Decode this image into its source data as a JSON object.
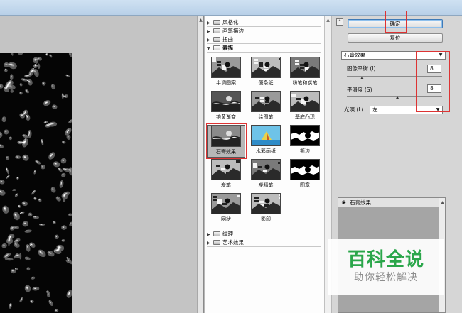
{
  "window": {
    "accent": "#b8d0e8"
  },
  "gallery": {
    "categories_top": [
      {
        "label": "风格化",
        "expanded": false
      },
      {
        "label": "画笔描边",
        "expanded": false
      },
      {
        "label": "扭曲",
        "expanded": false
      },
      {
        "label": "素描",
        "expanded": true
      }
    ],
    "filters": [
      {
        "label": "半调图案",
        "icon": "halftone-thumb"
      },
      {
        "label": "便条纸",
        "icon": "note-paper-thumb"
      },
      {
        "label": "粉笔和炭笔",
        "icon": "chalk-charcoal-thumb"
      },
      {
        "label": "铬黄渐变",
        "icon": "chrome-thumb"
      },
      {
        "label": "绘图笔",
        "icon": "graphic-pen-thumb"
      },
      {
        "label": "基底凸现",
        "icon": "bas-relief-thumb"
      },
      {
        "label": "石膏效果",
        "icon": "plaster-thumb",
        "selected": true
      },
      {
        "label": "水彩画纸",
        "icon": "water-paper-thumb"
      },
      {
        "label": "撕边",
        "icon": "torn-edges-thumb"
      },
      {
        "label": "炭笔",
        "icon": "charcoal-thumb"
      },
      {
        "label": "炭精笔",
        "icon": "conte-crayon-thumb"
      },
      {
        "label": "图章",
        "icon": "stamp-thumb"
      },
      {
        "label": "网状",
        "icon": "reticulation-thumb"
      },
      {
        "label": "影印",
        "icon": "photocopy-thumb"
      }
    ],
    "categories_bottom": [
      {
        "label": "纹理",
        "expanded": false
      },
      {
        "label": "艺术效果",
        "expanded": false
      }
    ]
  },
  "settings": {
    "ok_label": "确定",
    "reset_label": "复位",
    "filter_select": "石膏效果",
    "image_balance_label": "图像平衡 (I)",
    "image_balance_value": "8",
    "image_balance_level": 0.16,
    "smoothness_label": "平滑度 (S)",
    "smoothness_value": "8",
    "smoothness_level": 0.53,
    "light_label": "光照 (L):",
    "light_value": "左"
  },
  "layers": {
    "items": [
      {
        "label": "石膏效果",
        "icon": "eye-icon"
      }
    ]
  },
  "watermark": {
    "title": "百科全说",
    "subtitle": "助你轻松解决",
    "title_color": "#2aa64a"
  }
}
